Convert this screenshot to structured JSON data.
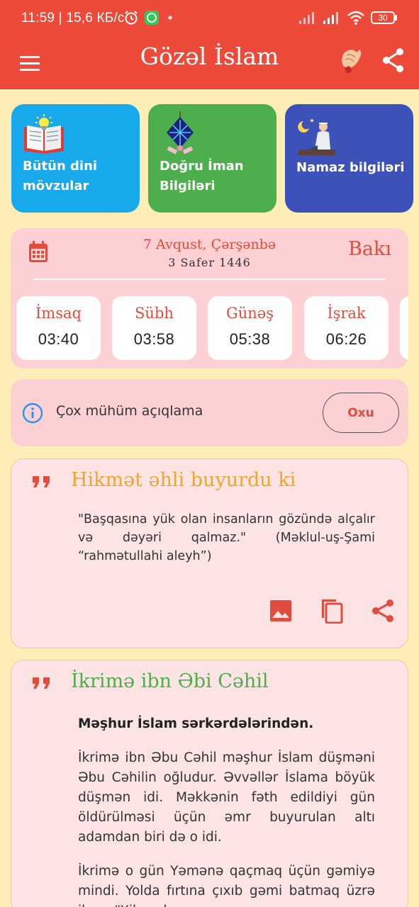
{
  "status_bar": {
    "time_text": "11:59 | 15,6 КБ/с",
    "battery": "30",
    "icons": [
      "alarm-icon",
      "whatsapp-icon",
      "dot-icon",
      "signal-icon",
      "signal-icon",
      "wifi-icon",
      "battery-icon"
    ]
  },
  "app_bar": {
    "title": "Gözəl İslam",
    "icons": [
      "menu-icon",
      "dua-hands-icon",
      "share-icon"
    ]
  },
  "categories": [
    {
      "label": "Bütün dini mövzular",
      "icon": "book-icon",
      "color": "#18a8ec"
    },
    {
      "label": "Doğru İman Bilgiləri",
      "icon": "lantern-icon",
      "color": "#4cae4c"
    },
    {
      "label": "Namaz bilgiləri",
      "icon": "praying-man-icon",
      "color": "#3d52b8"
    }
  ],
  "prayer": {
    "date": "7 Avqust, Çərşənbə",
    "hijri": "3 Safer 1446",
    "city": "Bakı",
    "times": [
      {
        "name": "İmsaq",
        "time": "03:40"
      },
      {
        "name": "Sübh",
        "time": "03:58"
      },
      {
        "name": "Günəş",
        "time": "05:38"
      },
      {
        "name": "İşrak",
        "time": "06:26"
      }
    ]
  },
  "notice": {
    "text": "Çox mühüm açıqlama",
    "button": "Oxu"
  },
  "quotes": [
    {
      "title": "Hikmət əhli buyurdu ki",
      "body": "\"Başqasına yük olan insanların gözündə alçalır və dəyəri qalmaz.\" (Məklul-uş-Şami “rahmətullahi aleyh”)",
      "actions": [
        "image-icon",
        "copy-icon",
        "share-icon"
      ]
    },
    {
      "title": "İkrimə ibn Əbi Cəhil",
      "lead": "Məşhur İslam sərkərdələrindən.",
      "paragraphs": [
        "İkrimə ibn Əbu Cəhil məşhur İslam düşməni Əbu Cəhilin oğludur. Əvvəllər İslama böyük düşmən idi. Məkkənin fəth edildiyi gün öldürülməsi üçün əmr buyurulan altı adamdan biri də o idi.",
        "İkrimə o gün Yəmənə qaçmaq üçün gəmiyə mindi. Yolda fırtına çıxıb gəmi batmaq üzrə ikən, “Xilas olsam"
      ]
    }
  ],
  "colors": {
    "primary": "#ee4a3a",
    "background": "#fdeeb8",
    "card_pink": "#fdd0d4",
    "accent_orange": "#f2a52a",
    "accent_green": "#4cae4c"
  }
}
